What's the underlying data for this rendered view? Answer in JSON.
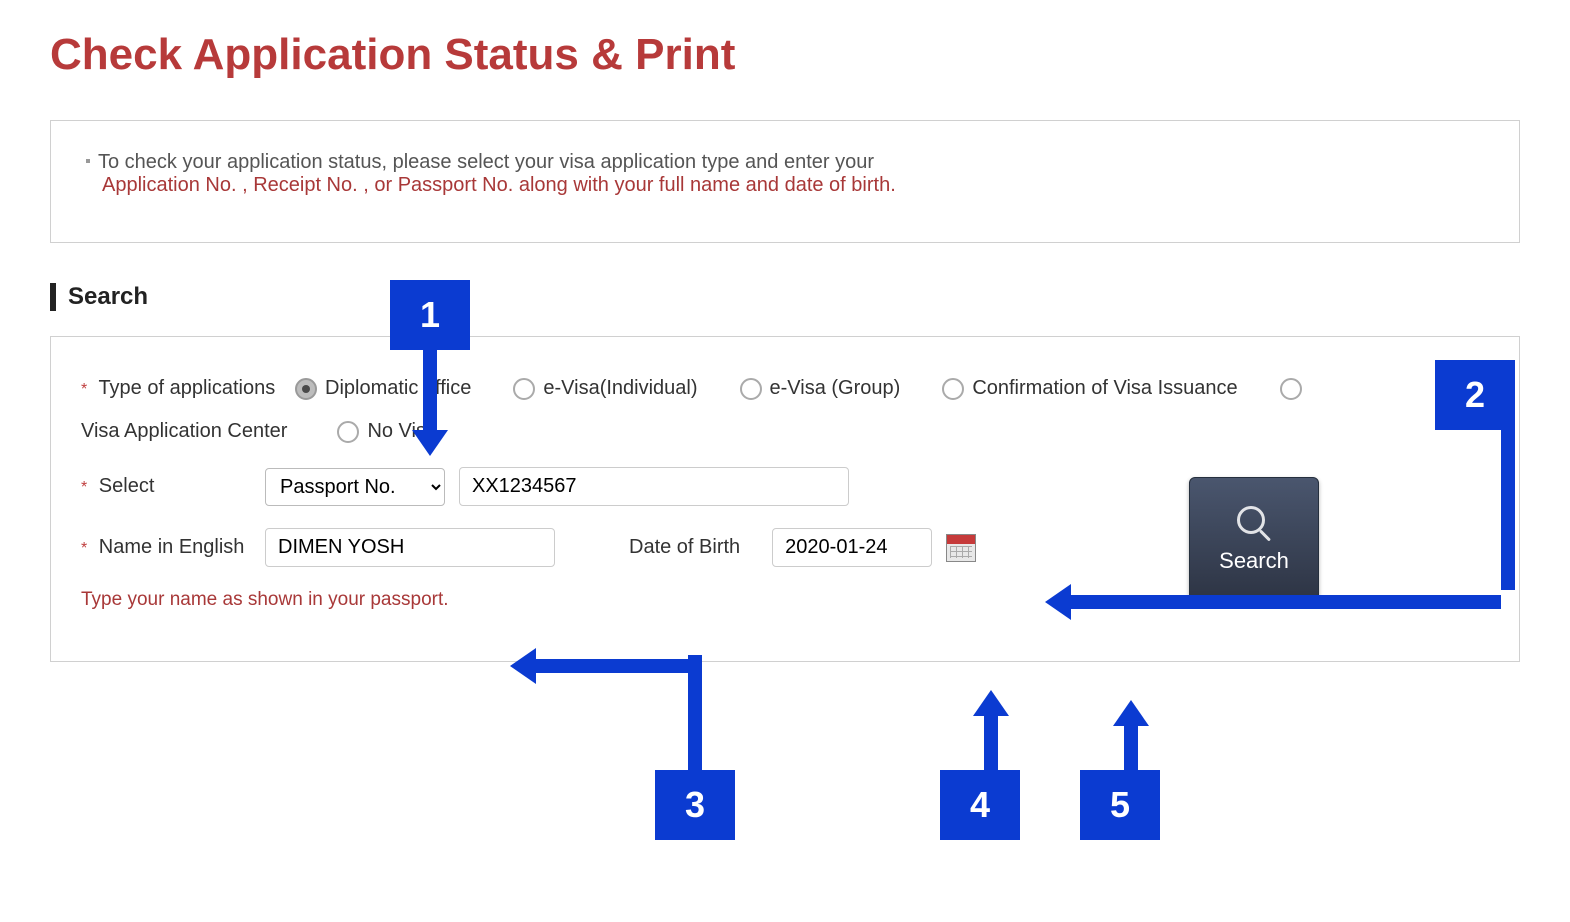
{
  "page": {
    "title": "Check Application Status & Print",
    "info_line1": "To check your application status, please select your visa application type and enter your",
    "info_line2": "Application No. , Receipt No. , or Passport No. along with your full name and date of birth.",
    "section_header": "Search"
  },
  "form": {
    "type_label": "Type of applications",
    "type_label_line2": "Visa Application Center",
    "radios": {
      "diplomatic": "Diplomatic office",
      "evisa_ind": "e-Visa(Individual)",
      "evisa_grp": "e-Visa (Group)",
      "confirmation": "Confirmation of Visa Issuance",
      "no_visa": "No Visa"
    },
    "select_label": "Select",
    "select_value": "Passport No.",
    "id_value": "XX1234567",
    "name_label": "Name in English",
    "name_value": "DIMEN YOSH",
    "name_hint": "Type your name as shown in your passport.",
    "dob_label": "Date of Birth",
    "dob_value": "2020-01-24",
    "search_button": "Search"
  },
  "annotations": {
    "a1": "1",
    "a2": "2",
    "a3": "3",
    "a4": "4",
    "a5": "5"
  }
}
